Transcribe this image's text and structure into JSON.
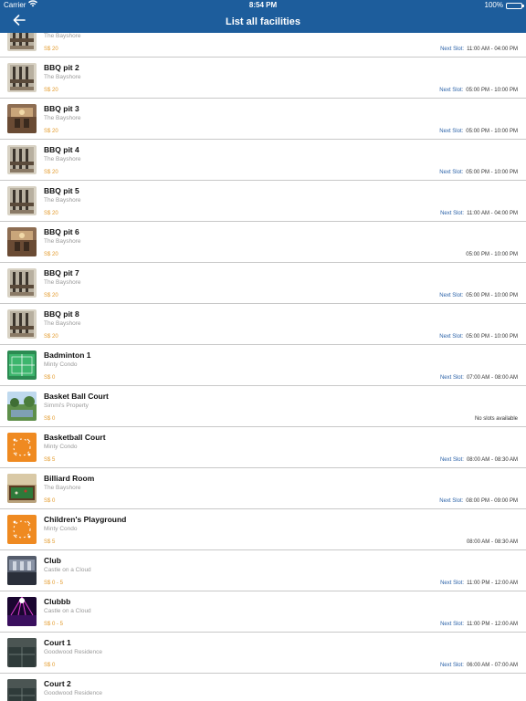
{
  "status_bar": {
    "carrier": "Carrier",
    "time": "8:54 PM",
    "battery": "100%"
  },
  "nav": {
    "title": "List all facilities",
    "back_icon": "back-arrow-icon"
  },
  "colors": {
    "nav_bg": "#1d5d9c",
    "price": "#e39a2b",
    "slot_label": "#2b62a8",
    "divider": "#c8c8c8"
  },
  "facilities": [
    {
      "name": "",
      "location": "The Bayshore",
      "price": "S$ 20",
      "slot_label": "Next Slot:",
      "slot_time": "11:00 AM - 04:00 PM",
      "thumb": "bbq"
    },
    {
      "name": "BBQ pit 2",
      "location": "The Bayshore",
      "price": "S$ 20",
      "slot_label": "Next Slot:",
      "slot_time": "05:00 PM - 10:00 PM",
      "thumb": "bbq"
    },
    {
      "name": "BBQ pit 3",
      "location": "The Bayshore",
      "price": "S$ 20",
      "slot_label": "Next Slot:",
      "slot_time": "05:00 PM - 10:00 PM",
      "thumb": "bbq2"
    },
    {
      "name": "BBQ pit 4",
      "location": "The Bayshore",
      "price": "S$ 20",
      "slot_label": "Next Slot:",
      "slot_time": "05:00 PM - 10:00 PM",
      "thumb": "bbq"
    },
    {
      "name": "BBQ pit 5",
      "location": "The Bayshore",
      "price": "S$ 20",
      "slot_label": "Next Slot:",
      "slot_time": "11:00 AM - 04:00 PM",
      "thumb": "bbq"
    },
    {
      "name": "BBQ pit 6",
      "location": "The Bayshore",
      "price": "S$ 20",
      "slot_label": "",
      "slot_time": "05:00 PM - 10:00 PM",
      "thumb": "bbq2"
    },
    {
      "name": "BBQ pit 7",
      "location": "The Bayshore",
      "price": "S$ 20",
      "slot_label": "Next Slot:",
      "slot_time": "05:00 PM - 10:00 PM",
      "thumb": "bbq"
    },
    {
      "name": "BBQ pit 8",
      "location": "The Bayshore",
      "price": "S$ 20",
      "slot_label": "Next Slot:",
      "slot_time": "05:00 PM - 10:00 PM",
      "thumb": "bbq"
    },
    {
      "name": "Badminton 1",
      "location": "Minty Condo",
      "price": "S$ 0",
      "slot_label": "Next Slot:",
      "slot_time": "07:00 AM - 08:00 AM",
      "thumb": "badminton"
    },
    {
      "name": "Basket Ball Court",
      "location": "Simmi's Property",
      "price": "S$ 0",
      "slot_label": "",
      "slot_time": "No slots available",
      "thumb": "park"
    },
    {
      "name": "Basketball Court",
      "location": "Minty Condo",
      "price": "S$ 5",
      "slot_label": "Next Slot:",
      "slot_time": "08:00 AM - 08:30 AM",
      "thumb": "orange"
    },
    {
      "name": "Billiard Room",
      "location": "The Bayshore",
      "price": "S$ 0",
      "slot_label": "Next Slot:",
      "slot_time": "08:00 PM - 09:00 PM",
      "thumb": "billiard"
    },
    {
      "name": "Children's Playground",
      "location": "Minty Condo",
      "price": "S$ 5",
      "slot_label": "",
      "slot_time": "08:00 AM - 08:30 AM",
      "thumb": "orange"
    },
    {
      "name": "Club",
      "location": "Castle on a Cloud",
      "price": "S$ 0 - 5",
      "slot_label": "Next Slot:",
      "slot_time": "11:00 PM - 12:00 AM",
      "thumb": "club"
    },
    {
      "name": "Clubbb",
      "location": "Castle on a Cloud",
      "price": "S$ 0 - 5",
      "slot_label": "Next Slot:",
      "slot_time": "11:00 PM - 12:00 AM",
      "thumb": "disco"
    },
    {
      "name": "Court 1",
      "location": "Goodwood Residence",
      "price": "S$ 0",
      "slot_label": "Next Slot:",
      "slot_time": "06:00 AM - 07:00 AM",
      "thumb": "court"
    },
    {
      "name": "Court 2",
      "location": "Goodwood Residence",
      "price": "",
      "slot_label": "",
      "slot_time": "",
      "thumb": "court"
    }
  ]
}
